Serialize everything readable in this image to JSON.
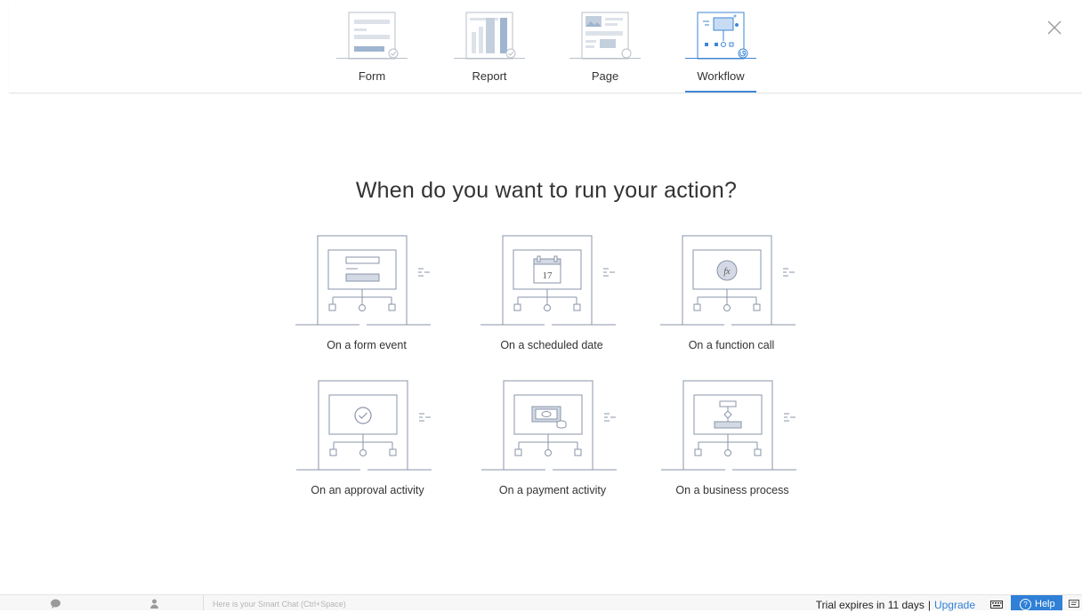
{
  "tabs": [
    {
      "label": "Form",
      "icon": "form-icon",
      "active": false
    },
    {
      "label": "Report",
      "icon": "report-icon",
      "active": false
    },
    {
      "label": "Page",
      "icon": "page-icon",
      "active": false
    },
    {
      "label": "Workflow",
      "icon": "workflow-icon",
      "active": true
    }
  ],
  "heading": "When do you want to run your action?",
  "options": [
    {
      "label": "On a form event",
      "icon": "form-event-icon"
    },
    {
      "label": "On a scheduled date",
      "icon": "scheduled-date-icon",
      "date_number": "17"
    },
    {
      "label": "On a function call",
      "icon": "function-call-icon",
      "symbol": "fx"
    },
    {
      "label": "On an approval activity",
      "icon": "approval-icon"
    },
    {
      "label": "On a payment activity",
      "icon": "payment-icon"
    },
    {
      "label": "On a business process",
      "icon": "business-process-icon"
    }
  ],
  "bottom_bar": {
    "smart_chat_placeholder": "Here is your Smart Chat (Ctrl+Space)",
    "trial_text": "Trial expires in 11 days",
    "separator": "|",
    "upgrade_label": "Upgrade",
    "help_label": "Help"
  },
  "colors": {
    "accent": "#3f86d4",
    "line_art": "#8a94a8",
    "help_button": "#2f80d6"
  }
}
